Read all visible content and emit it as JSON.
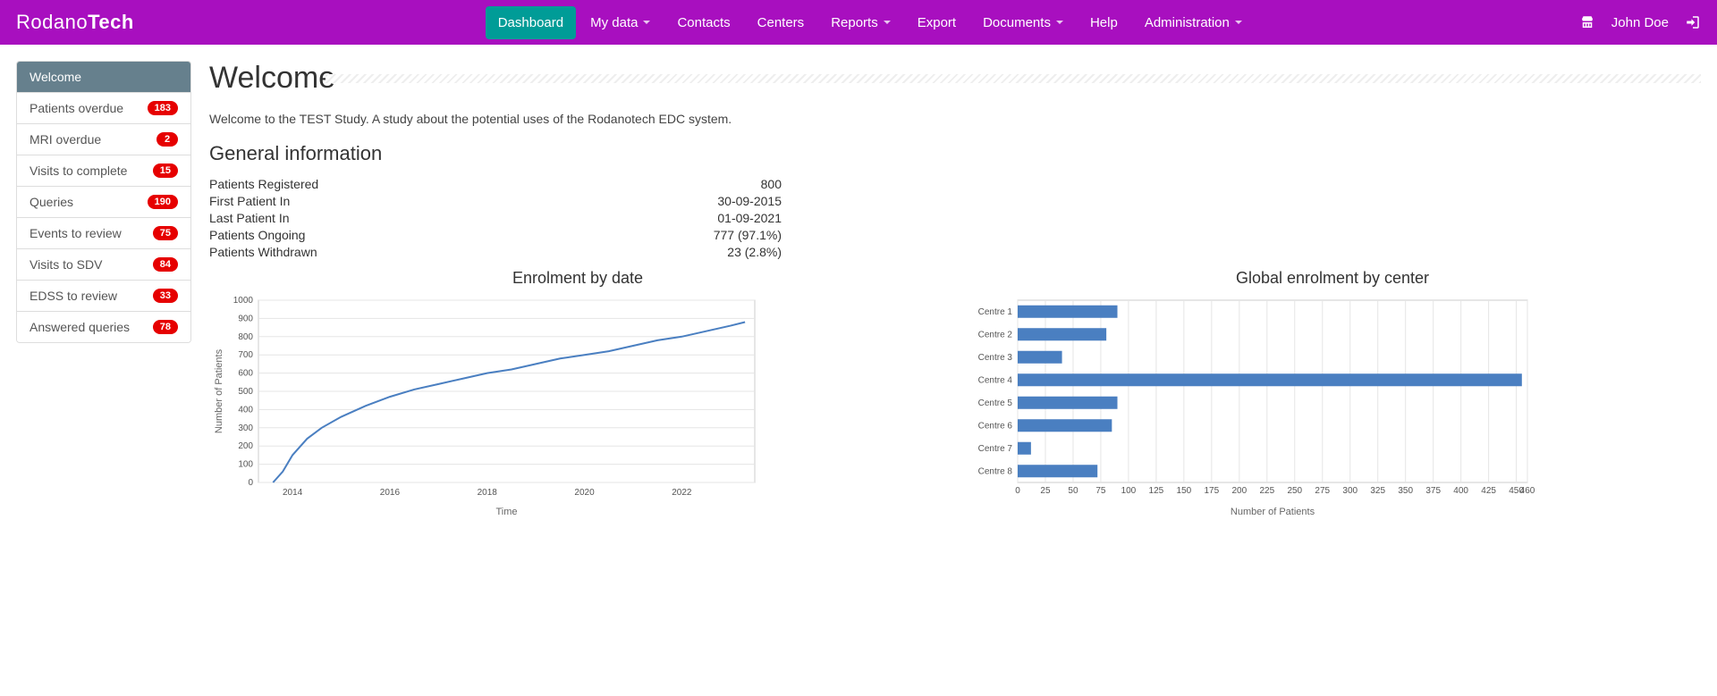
{
  "brand": {
    "part1": "Rodano",
    "part2": "Tech"
  },
  "nav": {
    "items": [
      {
        "label": "Dashboard",
        "active": true,
        "dropdown": false
      },
      {
        "label": "My data",
        "dropdown": true
      },
      {
        "label": "Contacts",
        "dropdown": false
      },
      {
        "label": "Centers",
        "dropdown": false
      },
      {
        "label": "Reports",
        "dropdown": true
      },
      {
        "label": "Export",
        "dropdown": false
      },
      {
        "label": "Documents",
        "dropdown": true
      },
      {
        "label": "Help",
        "dropdown": false
      },
      {
        "label": "Administration",
        "dropdown": true
      }
    ]
  },
  "user": {
    "name": "John Doe"
  },
  "sidebar": {
    "items": [
      {
        "label": "Welcome",
        "active": true
      },
      {
        "label": "Patients overdue",
        "badge": "183"
      },
      {
        "label": "MRI overdue",
        "badge": "2"
      },
      {
        "label": "Visits to complete",
        "badge": "15"
      },
      {
        "label": "Queries",
        "badge": "190"
      },
      {
        "label": "Events to review",
        "badge": "75"
      },
      {
        "label": "Visits to SDV",
        "badge": "84"
      },
      {
        "label": "EDSS to review",
        "badge": "33"
      },
      {
        "label": "Answered queries",
        "badge": "78"
      }
    ]
  },
  "main": {
    "title": "Welcome",
    "intro": "Welcome to the TEST Study. A study about the potential uses of the Rodanotech EDC system.",
    "general_heading": "General information",
    "info": [
      {
        "label": "Patients Registered",
        "value": "800"
      },
      {
        "label": "First Patient In",
        "value": "30-09-2015"
      },
      {
        "label": "Last Patient In",
        "value": "01-09-2021"
      },
      {
        "label": "Patients Ongoing",
        "value": "777 (97.1%)"
      },
      {
        "label": "Patients Withdrawn",
        "value": "23 (2.8%)"
      }
    ],
    "chart1_title": "Enrolment by date",
    "chart2_title": "Global enrolment by center"
  },
  "chart_data": [
    {
      "type": "line",
      "title": "Enrolment by date",
      "xlabel": "Time",
      "ylabel": "Number of Patients",
      "ylim": [
        0,
        1000
      ],
      "yticks": [
        0,
        100,
        200,
        300,
        400,
        500,
        600,
        700,
        800,
        900,
        1000
      ],
      "xticks": [
        2014,
        2016,
        2018,
        2020,
        2022
      ],
      "x": [
        2013.6,
        2013.8,
        2014.0,
        2014.3,
        2014.6,
        2015.0,
        2015.5,
        2016.0,
        2016.5,
        2017.0,
        2017.5,
        2018.0,
        2018.5,
        2019.0,
        2019.5,
        2020.0,
        2020.5,
        2021.0,
        2021.5,
        2022.0,
        2022.5,
        2023.0,
        2023.3
      ],
      "y": [
        0,
        60,
        150,
        240,
        300,
        360,
        420,
        470,
        510,
        540,
        570,
        600,
        620,
        650,
        680,
        700,
        720,
        750,
        780,
        800,
        830,
        860,
        880
      ]
    },
    {
      "type": "bar",
      "orientation": "horizontal",
      "title": "Global enrolment by center",
      "xlabel": "Number of Patients",
      "xlim": [
        0,
        460
      ],
      "xticks": [
        0,
        25,
        50,
        75,
        100,
        125,
        150,
        175,
        200,
        225,
        250,
        275,
        300,
        325,
        350,
        375,
        400,
        425,
        450,
        460
      ],
      "categories": [
        "Centre 1",
        "Centre 2",
        "Centre 3",
        "Centre 4",
        "Centre 5",
        "Centre 6",
        "Centre 7",
        "Centre 8"
      ],
      "values": [
        90,
        80,
        40,
        455,
        90,
        85,
        12,
        72
      ]
    }
  ]
}
